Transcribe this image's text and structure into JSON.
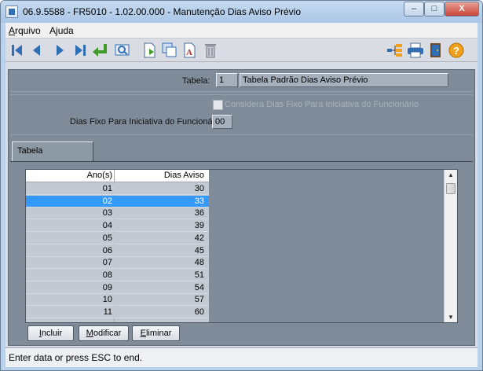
{
  "window": {
    "title": "06.9.5588 - FR5010 - 1.02.00.000 - Manutenção Dias Aviso Prévio",
    "buttons": {
      "minimize": "–",
      "maximize": "□",
      "close": "X"
    }
  },
  "menu": [
    {
      "label": "Arquivo",
      "underline": "A"
    },
    {
      "label": "Ajuda",
      "underline": "j"
    }
  ],
  "toolbar": {
    "icons": [
      "first-record-icon",
      "previous-record-icon",
      "next-record-icon",
      "last-record-icon",
      "goto-icon",
      "search-icon",
      "new-record-icon",
      "copy-icon",
      "edit-icon",
      "delete-icon",
      "tree-icon",
      "print-icon",
      "exit-icon",
      "help-icon"
    ],
    "colors": {
      "blue": "#2f6db5",
      "green": "#3f9a2a",
      "orange": "#f0a01a"
    }
  },
  "header": {
    "tabela_label": "Tabela:",
    "tabela_code": "1",
    "tabela_desc": "Tabela Padrão Dias Aviso Prévio"
  },
  "options": {
    "considera_label": "Considera Dias Fixo Para Iniciativa do Funcionário",
    "considera_checked": false,
    "dias_fixo_label": "Dias Fixo Para Iniciativa do Funcionário:",
    "dias_fixo_value": "00"
  },
  "tab": {
    "label": "Tabela"
  },
  "grid": {
    "columns": [
      "Ano(s)",
      "Dias Aviso"
    ],
    "rows": [
      [
        "01",
        "30"
      ],
      [
        "02",
        "33"
      ],
      [
        "03",
        "36"
      ],
      [
        "04",
        "39"
      ],
      [
        "05",
        "42"
      ],
      [
        "06",
        "45"
      ],
      [
        "07",
        "48"
      ],
      [
        "08",
        "51"
      ],
      [
        "09",
        "54"
      ],
      [
        "10",
        "57"
      ],
      [
        "11",
        "60"
      ]
    ],
    "selected_index": 1
  },
  "buttons": {
    "incluir": "Incluir",
    "modificar": "Modificar",
    "eliminar": "Eliminar"
  },
  "status": {
    "text": "Enter data or press ESC to end."
  }
}
